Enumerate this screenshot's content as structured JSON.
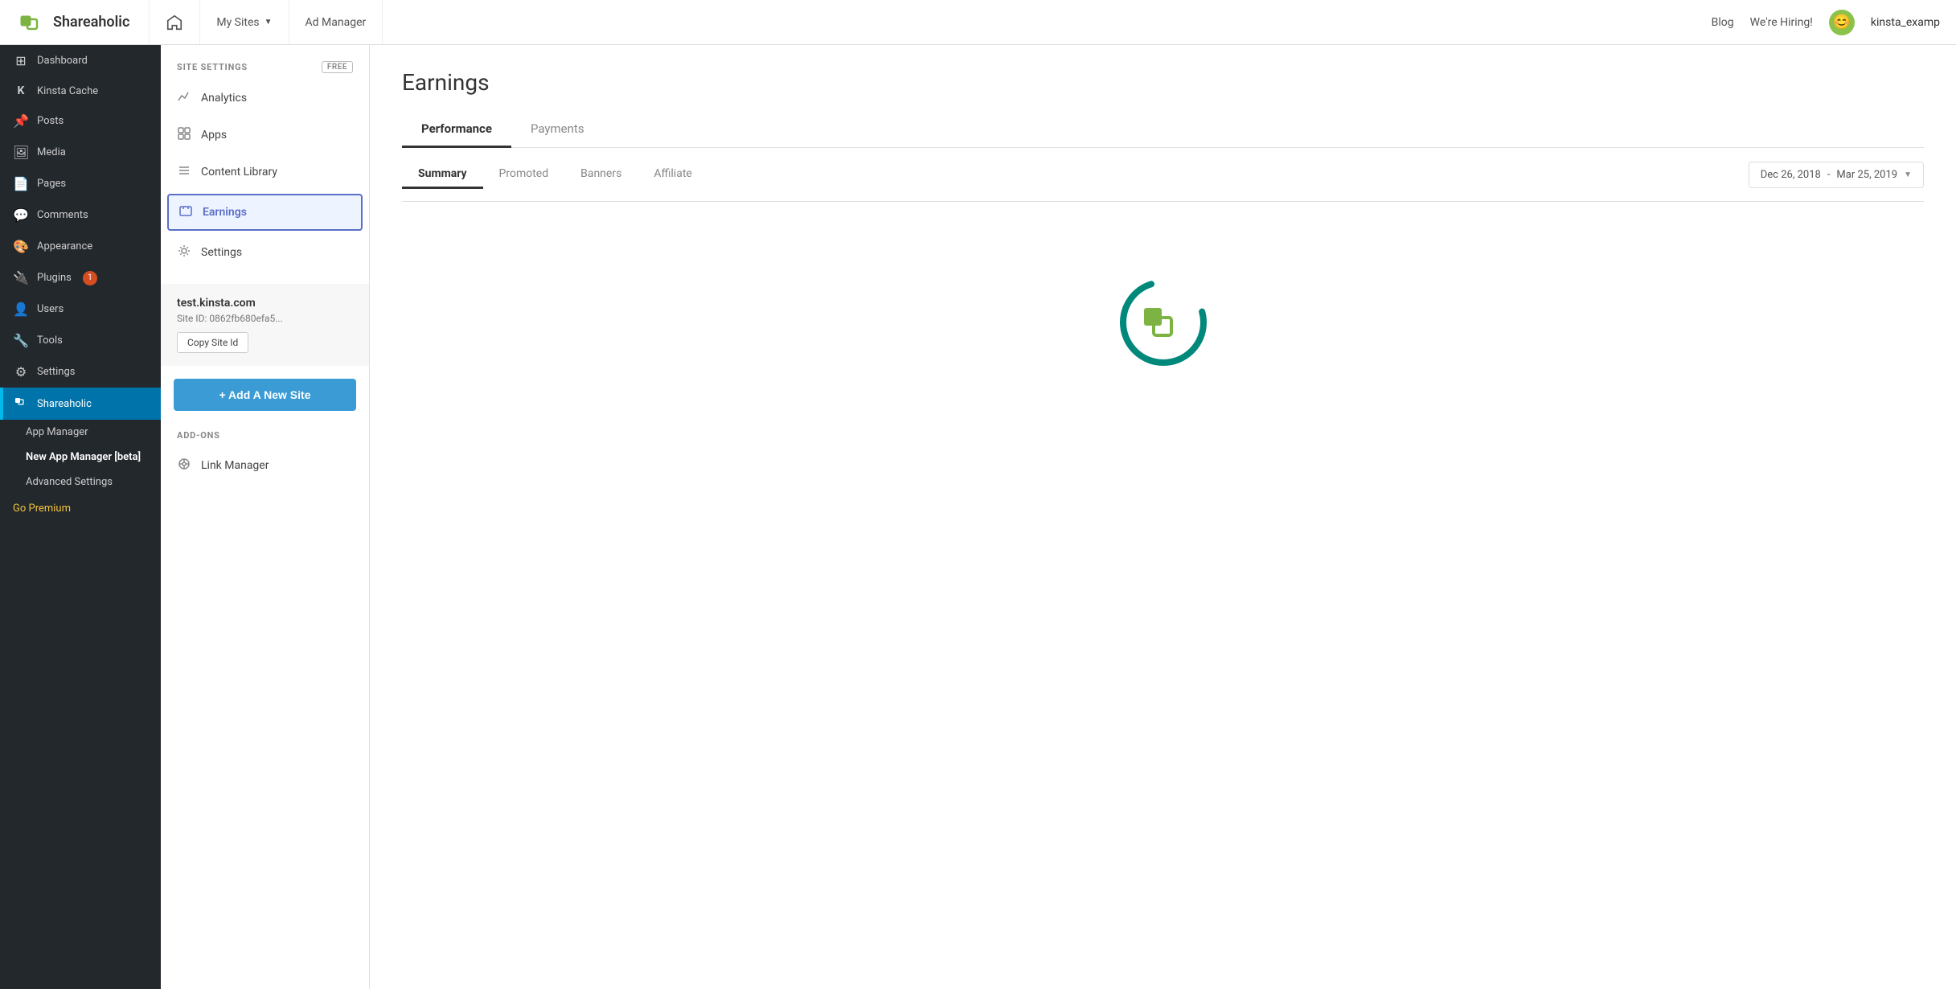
{
  "topnav": {
    "logo_text": "Shareaholic",
    "home_label": "Home",
    "mysites_label": "My Sites",
    "admanager_label": "Ad Manager",
    "blog_label": "Blog",
    "hiring_label": "We're Hiring!",
    "username": "kinsta_examp",
    "avatar_emoji": "😊"
  },
  "wp_sidebar": {
    "items": [
      {
        "id": "dashboard",
        "label": "Dashboard",
        "icon": "⊞"
      },
      {
        "id": "kinsta-cache",
        "label": "Kinsta Cache",
        "icon": "K"
      },
      {
        "id": "posts",
        "label": "Posts",
        "icon": "📌"
      },
      {
        "id": "media",
        "label": "Media",
        "icon": "🖼"
      },
      {
        "id": "pages",
        "label": "Pages",
        "icon": "📄"
      },
      {
        "id": "comments",
        "label": "Comments",
        "icon": "💬"
      },
      {
        "id": "appearance",
        "label": "Appearance",
        "icon": "🎨"
      },
      {
        "id": "plugins",
        "label": "Plugins",
        "icon": "🔌",
        "badge": "1"
      },
      {
        "id": "users",
        "label": "Users",
        "icon": "👤"
      },
      {
        "id": "tools",
        "label": "Tools",
        "icon": "🔧"
      },
      {
        "id": "settings",
        "label": "Settings",
        "icon": "⚙"
      },
      {
        "id": "shareaholic",
        "label": "Shareaholic",
        "icon": "⬡",
        "active": true
      }
    ],
    "subitems": [
      {
        "id": "app-manager",
        "label": "App Manager"
      },
      {
        "id": "new-app-manager",
        "label": "New App Manager [beta]",
        "active": true
      }
    ],
    "advanced_settings": "Advanced Settings",
    "go_premium": "Go Premium"
  },
  "plugin_sidebar": {
    "section_label": "SITE SETTINGS",
    "free_badge": "Free",
    "items": [
      {
        "id": "analytics",
        "label": "Analytics",
        "icon": "📈"
      },
      {
        "id": "apps",
        "label": "Apps",
        "icon": "📋"
      },
      {
        "id": "content-library",
        "label": "Content Library",
        "icon": "☰"
      },
      {
        "id": "earnings",
        "label": "Earnings",
        "icon": "💼",
        "active": true
      },
      {
        "id": "settings",
        "label": "Settings",
        "icon": "⚙"
      }
    ],
    "site": {
      "name": "test.kinsta.com",
      "id_label": "Site ID:",
      "id_value": "0862fb680efa5...",
      "copy_button": "Copy Site Id"
    },
    "add_site_button": "+ Add A New Site",
    "addons_label": "ADD-ONS",
    "addon_items": [
      {
        "id": "link-manager",
        "label": "Link Manager",
        "icon": "🎯"
      }
    ]
  },
  "main_content": {
    "page_title": "Earnings",
    "tabs": [
      {
        "id": "performance",
        "label": "Performance",
        "active": true
      },
      {
        "id": "payments",
        "label": "Payments"
      }
    ],
    "sub_tabs": [
      {
        "id": "summary",
        "label": "Summary",
        "active": true
      },
      {
        "id": "promoted",
        "label": "Promoted"
      },
      {
        "id": "banners",
        "label": "Banners"
      },
      {
        "id": "affiliate",
        "label": "Affiliate"
      }
    ],
    "date_range": {
      "start": "Dec 26, 2018",
      "separator": "-",
      "end": "Mar 25, 2019"
    }
  },
  "colors": {
    "accent_blue": "#3a9bd5",
    "active_tab_border": "#333",
    "sidebar_active": "#0073aa",
    "earnings_active": "#5b6ec8",
    "spinner_green": "#00897b",
    "logo_green": "#7cb342",
    "premium_yellow": "#f0c33c"
  }
}
